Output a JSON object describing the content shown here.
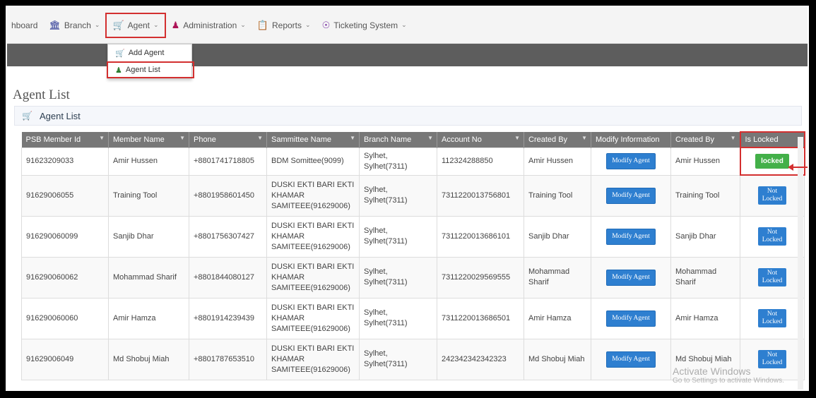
{
  "nav": {
    "items": [
      {
        "label": "hboard",
        "icon": "",
        "chevron": false
      },
      {
        "label": "Branch",
        "icon": "bank-icon",
        "chevron": true
      },
      {
        "label": "Agent",
        "icon": "cart-icon",
        "chevron": true
      },
      {
        "label": "Administration",
        "icon": "user-icon",
        "chevron": true
      },
      {
        "label": "Reports",
        "icon": "document-icon",
        "chevron": true
      },
      {
        "label": "Ticketing System",
        "icon": "ticket-icon",
        "chevron": true
      }
    ]
  },
  "dropdown": {
    "add_agent": "Add Agent",
    "agent_list": "Agent List"
  },
  "page": {
    "title": "Agent List",
    "panel_title": "Agent List"
  },
  "table": {
    "headers": [
      "PSB Member Id",
      "Member Name",
      "Phone",
      "Sammittee Name",
      "Branch Name",
      "Account No",
      "Created By",
      "Modify Information",
      "Created By",
      "Is Locked"
    ],
    "rows": [
      {
        "id": "91623209033",
        "name": "Amir Hussen",
        "phone": "+8801741718805",
        "sammittee": "BDM Somittee(9099)",
        "branch": "Sylhet, Sylhet(7311)",
        "account": "112324288850",
        "created_by": "Amir Hussen",
        "modify": "Modify Agent",
        "created_by2": "Amir Hussen",
        "lock": "locked",
        "is_locked": true
      },
      {
        "id": "91629006055",
        "name": "Training Tool",
        "phone": "+8801958601450",
        "sammittee": "DUSKI EKTI BARI EKTI KHAMAR SAMITEEE(91629006)",
        "branch": "Sylhet, Sylhet(7311)",
        "account": "7311220013756801",
        "created_by": "Training Tool",
        "modify": "Modify Agent",
        "created_by2": "Training Tool",
        "lock": "Not Locked",
        "is_locked": false
      },
      {
        "id": "916290060099",
        "name": "Sanjib Dhar",
        "phone": "+8801756307427",
        "sammittee": "DUSKI EKTI BARI EKTI KHAMAR SAMITEEE(91629006)",
        "branch": "Sylhet, Sylhet(7311)",
        "account": "7311220013686101",
        "created_by": "Sanjib Dhar",
        "modify": "Modify Agent",
        "created_by2": "Sanjib Dhar",
        "lock": "Not Locked",
        "is_locked": false
      },
      {
        "id": "916290060062",
        "name": "Mohammad Sharif",
        "phone": "+8801844080127",
        "sammittee": "DUSKI EKTI BARI EKTI KHAMAR SAMITEEE(91629006)",
        "branch": "Sylhet, Sylhet(7311)",
        "account": "7311220029569555",
        "created_by": "Mohammad Sharif",
        "modify": "Modify Agent",
        "created_by2": "Mohammad Sharif",
        "lock": "Not Locked",
        "is_locked": false
      },
      {
        "id": "916290060060",
        "name": "Amir Hamza",
        "phone": "+8801914239439",
        "sammittee": "DUSKI EKTI BARI EKTI KHAMAR SAMITEEE(91629006)",
        "branch": "Sylhet, Sylhet(7311)",
        "account": "7311220013686501",
        "created_by": "Amir Hamza",
        "modify": "Modify Agent",
        "created_by2": "Amir Hamza",
        "lock": "Not Locked",
        "is_locked": false
      },
      {
        "id": "91629006049",
        "name": "Md Shobuj Miah",
        "phone": "+8801787653510",
        "sammittee": "DUSKI EKTI BARI EKTI KHAMAR SAMITEEE(91629006)",
        "branch": "Sylhet, Sylhet(7311)",
        "account": "242342342342323",
        "created_by": "Md Shobuj Miah",
        "modify": "Modify Agent",
        "created_by2": "Md Shobuj Miah",
        "lock": "Not Locked",
        "is_locked": false
      }
    ]
  },
  "watermark": {
    "line1": "Activate Windows",
    "line2": "Go to Settings to activate Windows."
  },
  "colors": {
    "highlight": "#d32f2f",
    "header_bg": "#777777",
    "modify_btn": "#2e7fd0",
    "locked_btn": "#43b049"
  }
}
